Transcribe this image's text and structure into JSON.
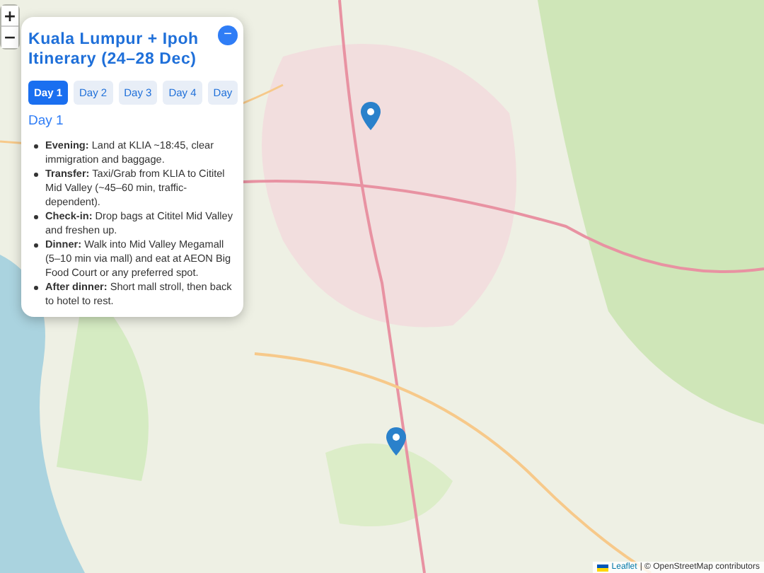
{
  "zoom_controls": [
    "+",
    "−"
  ],
  "panel": {
    "title": "Kuala Lumpur + Ipoh Itinerary (24–28 Dec)",
    "collapse": "−",
    "tabs": [
      {
        "label": "Day 1",
        "selected": true
      },
      {
        "label": "Day 2",
        "selected": false
      },
      {
        "label": "Day 3",
        "selected": false
      },
      {
        "label": "Day 4",
        "selected": false
      },
      {
        "label": "Day",
        "selected": false
      }
    ],
    "day_heading": "Day 1",
    "items": [
      "**Evening:** Land at KLIA ~18:45, clear immigration and baggage.",
      "**Transfer:** Taxi/Grab from KLIA to Cititel Mid Valley (~45–60 min, traffic-dependent).",
      "**Check-in:** Drop bags at Cititel Mid Valley and freshen up.",
      "**Dinner:** Walk into Mid Valley Megamall (5–10 min via mall) and eat at AEON Big Food Court or any preferred spot.",
      "**After dinner:** Short mall stroll, then back to hotel to rest."
    ]
  },
  "attribution": {
    "link": "Leaflet",
    "rest": "| © OpenStreetMap contributors"
  }
}
